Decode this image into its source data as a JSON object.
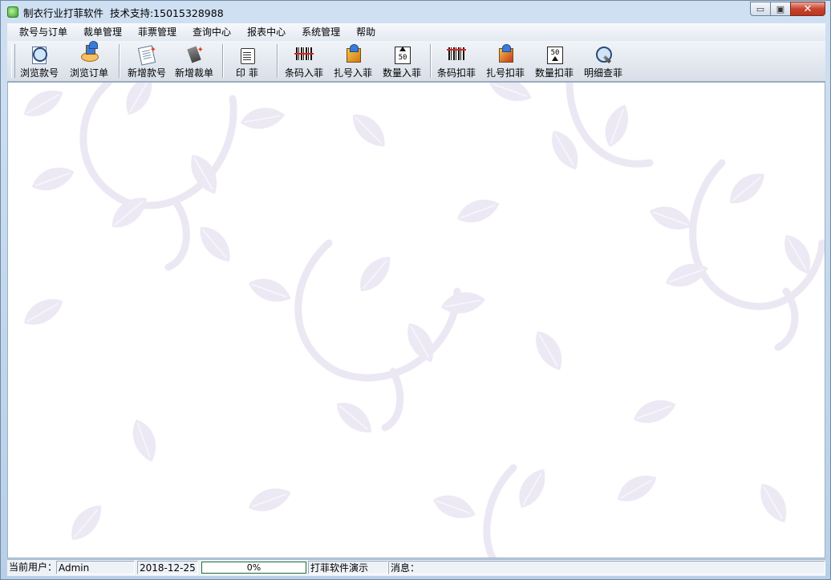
{
  "window": {
    "title": "制衣行业打菲软件",
    "support": "技术支持:15015328988",
    "controls": {
      "minimize": "▭",
      "maximize": "▣",
      "close": "✕"
    }
  },
  "menu": {
    "items": [
      "款号与订单",
      "裁单管理",
      "菲票管理",
      "查询中心",
      "报表中心",
      "系统管理",
      "帮助"
    ]
  },
  "toolbar": {
    "buttons": [
      {
        "label": "浏览款号",
        "icon": "magnifier-doc-icon"
      },
      {
        "label": "浏览订单",
        "icon": "order-hand-icon"
      },
      {
        "label": "新增款号",
        "icon": "new-style-icon"
      },
      {
        "label": "新增裁单",
        "icon": "new-cut-icon"
      },
      {
        "label": "印  菲",
        "icon": "print-ticket-icon"
      },
      {
        "label": "条码入菲",
        "icon": "barcode-in-icon"
      },
      {
        "label": "扎号入菲",
        "icon": "bundle-in-icon"
      },
      {
        "label": "数量入菲",
        "icon": "quantity-in-icon"
      },
      {
        "label": "条码扣菲",
        "icon": "barcode-deduct-icon"
      },
      {
        "label": "扎号扣菲",
        "icon": "bundle-deduct-icon"
      },
      {
        "label": "数量扣菲",
        "icon": "quantity-deduct-icon"
      },
      {
        "label": "明细查菲",
        "icon": "detail-search-icon"
      }
    ]
  },
  "statusbar": {
    "user_label": "当前用户：",
    "user": "Admin",
    "date": "2018-12-25",
    "progress_text": "0%",
    "progress": 0,
    "mode": "打菲软件演示",
    "message_label": "消息："
  }
}
